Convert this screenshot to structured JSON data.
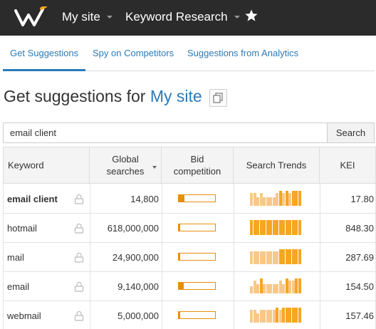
{
  "nav": {
    "site": "My site",
    "section": "Keyword Research"
  },
  "tabs": [
    {
      "label": "Get Suggestions",
      "active": true
    },
    {
      "label": "Spy on Competitors",
      "active": false
    },
    {
      "label": "Suggestions from Analytics",
      "active": false
    }
  ],
  "heading": {
    "prefix": "Get suggestions for ",
    "site": "My site"
  },
  "search": {
    "value": "email client",
    "button": "Search"
  },
  "table": {
    "headers": {
      "keyword": "Keyword",
      "global_searches_1": "Global",
      "global_searches_2": "searches",
      "bid_1": "Bid",
      "bid_2": "competition",
      "trends": "Search Trends",
      "kei": "KEI"
    },
    "rows": [
      {
        "keyword": "email client",
        "bold": true,
        "global": "14,800",
        "bid": 0.15,
        "trend": [
          0.8,
          0.8,
          0.55,
          0.8,
          0.55,
          0.55,
          0.55,
          0.55,
          0.8,
          0.95,
          0.8,
          0.95,
          0.8,
          0.95,
          0.95,
          0.95
        ],
        "kei": "17.80"
      },
      {
        "keyword": "hotmail",
        "bold": false,
        "global": "618,000,000",
        "bid": 0.02,
        "trend": [
          0.95,
          0.95,
          0.95,
          0.95,
          0.95,
          0.95,
          0.95,
          0.95,
          0.95,
          0.95,
          0.95,
          0.95,
          0.95,
          0.95,
          0.95,
          0.95
        ],
        "kei": "848.30"
      },
      {
        "keyword": "mail",
        "bold": false,
        "global": "24,900,000",
        "bid": 0.02,
        "trend": [
          0.8,
          0.8,
          0.8,
          0.8,
          0.8,
          0.8,
          0.8,
          0.8,
          0.8,
          0.95,
          0.95,
          0.95,
          0.95,
          0.95,
          0.95,
          0.95
        ],
        "kei": "287.69"
      },
      {
        "keyword": "email",
        "bold": false,
        "global": "9,140,000",
        "bid": 0.13,
        "trend": [
          0.45,
          0.8,
          0.6,
          0.95,
          0.6,
          0.6,
          0.6,
          0.6,
          0.6,
          0.8,
          0.6,
          0.95,
          0.8,
          0.8,
          0.95,
          0.95
        ],
        "kei": "154.50"
      },
      {
        "keyword": "webmail",
        "bold": false,
        "global": "5,000,000",
        "bid": 0.04,
        "trend": [
          0.8,
          0.8,
          0.6,
          0.8,
          0.8,
          0.8,
          0.8,
          0.8,
          0.95,
          0.8,
          0.95,
          0.95,
          0.95,
          0.95,
          0.95,
          0.95
        ],
        "kei": "157.46"
      }
    ]
  },
  "colors": {
    "topbar": "#2b2b2b",
    "link": "#2a7ab9",
    "accent": "#e88e0c",
    "trend_dark": "#f5a623",
    "trend_light": "#f8c88a"
  }
}
